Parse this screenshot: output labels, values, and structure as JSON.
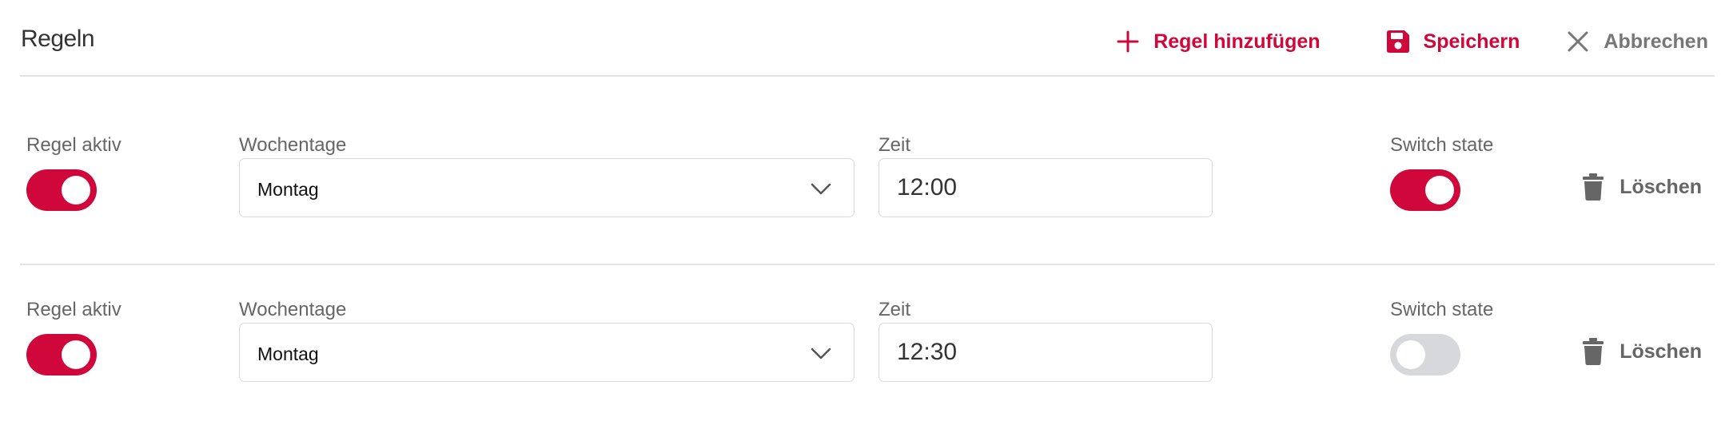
{
  "header": {
    "title": "Regeln",
    "actions": {
      "add_label": "Regel hinzufügen",
      "save_label": "Speichern",
      "cancel_label": "Abbrechen"
    }
  },
  "labels": {
    "rule_active": "Regel aktiv",
    "weekdays": "Wochentage",
    "time": "Zeit",
    "switch_state": "Switch state",
    "delete": "Löschen"
  },
  "rules": [
    {
      "active": true,
      "weekday": "Montag",
      "time": "12:00",
      "switch_state": true
    },
    {
      "active": true,
      "weekday": "Montag",
      "time": "12:30",
      "switch_state": false
    }
  ],
  "icons": {
    "add": "plus-icon",
    "save": "floppy-disk-icon",
    "cancel": "close-icon",
    "dropdown": "chevron-down-icon",
    "delete": "trash-icon"
  },
  "colors": {
    "accent": "#d0073b",
    "toggle_off": "#d6d8dc",
    "muted_text": "#666666",
    "divider": "#e3e3e3"
  }
}
